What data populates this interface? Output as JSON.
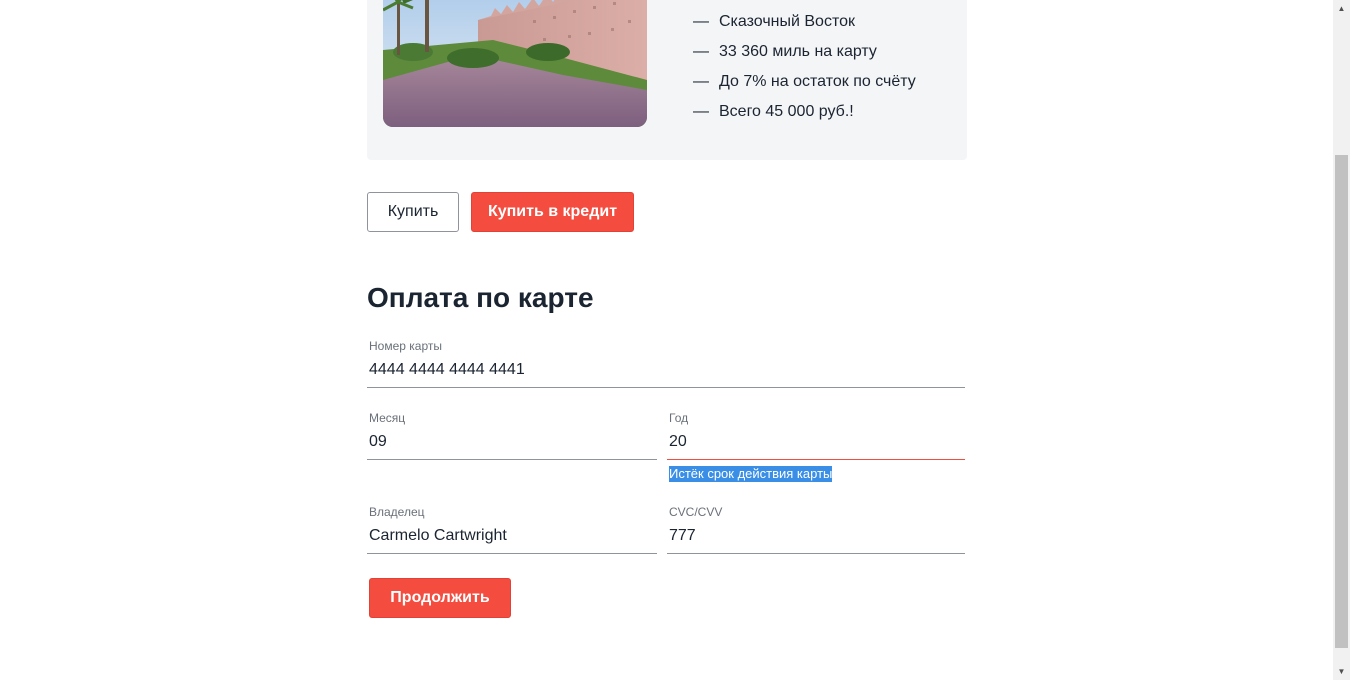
{
  "offer": {
    "image_alt": "city-wall-photo",
    "features": [
      "Сказочный Восток",
      "33 360 миль на карту",
      "До 7% на остаток по счёту",
      "Всего 45 000 руб.!"
    ],
    "dash": "—"
  },
  "buttons": {
    "buy_label": "Купить",
    "buy_credit_label": "Купить в кредит",
    "continue_label": "Продолжить"
  },
  "payment": {
    "title": "Оплата по карте",
    "card_number": {
      "label": "Номер карты",
      "value": "4444 4444 4444 4441"
    },
    "month": {
      "label": "Месяц",
      "value": "09"
    },
    "year": {
      "label": "Год",
      "value": "20",
      "error": "Истёк срок действия карты"
    },
    "owner": {
      "label": "Владелец",
      "value": "Carmelo Cartwright"
    },
    "cvc": {
      "label": "CVC/CVV",
      "value": "777"
    }
  },
  "colors": {
    "accent_red": "#f44c3f",
    "text_dark": "#1b2431",
    "card_bg": "#f4f5f7",
    "selection_blue": "#3a8ee6"
  }
}
